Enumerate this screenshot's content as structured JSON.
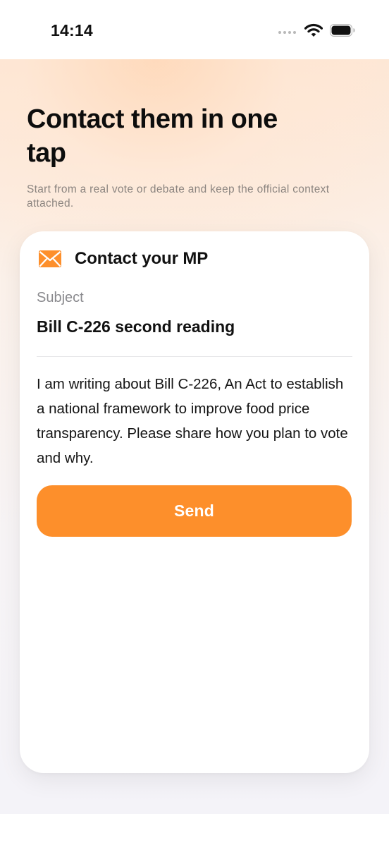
{
  "status_bar": {
    "time": "14:14",
    "icons": [
      "signal-dots-icon",
      "wifi-icon",
      "battery-icon"
    ]
  },
  "hero": {
    "title": "Contact them in one tap",
    "subtitle": "Start from a real vote or debate and keep the official context attached."
  },
  "card": {
    "icon": "envelope-icon",
    "title": "Contact your MP",
    "subject_label": "Subject",
    "subject_value": "Bill C-226 second reading",
    "message": "I am writing about Bill C-226, An Act to establish a national framework to improve food price transparency. Please share how you plan to vote and why.",
    "send_label": "Send"
  },
  "colors": {
    "accent": "#fd8f2b",
    "text_primary": "#111111",
    "text_secondary": "#8a8a8e"
  }
}
